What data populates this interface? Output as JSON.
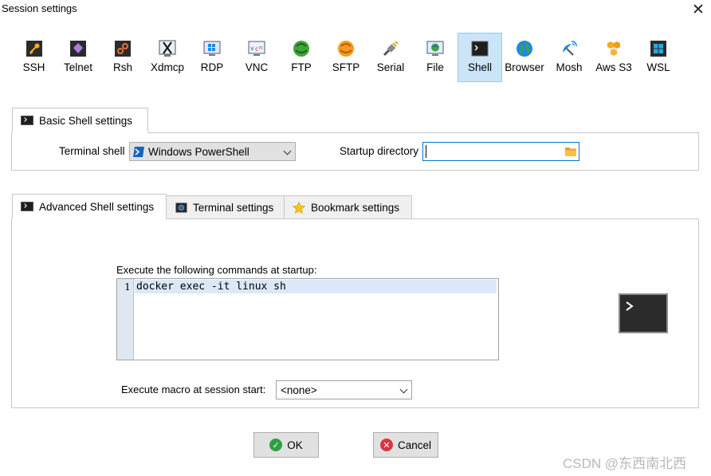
{
  "window": {
    "title": "Session settings",
    "close_glyph": "✕"
  },
  "toolbar": {
    "selected": "Shell",
    "items": [
      {
        "label": "SSH",
        "icon": "key-icon"
      },
      {
        "label": "Telnet",
        "icon": "telnet-icon"
      },
      {
        "label": "Rsh",
        "icon": "rsh-icon"
      },
      {
        "label": "Xdmcp",
        "icon": "xdmcp-icon"
      },
      {
        "label": "RDP",
        "icon": "rdp-icon"
      },
      {
        "label": "VNC",
        "icon": "vnc-icon"
      },
      {
        "label": "FTP",
        "icon": "ftp-icon"
      },
      {
        "label": "SFTP",
        "icon": "sftp-icon"
      },
      {
        "label": "Serial",
        "icon": "serial-plug-icon"
      },
      {
        "label": "File",
        "icon": "file-icon"
      },
      {
        "label": "Shell",
        "icon": "terminal-icon"
      },
      {
        "label": "Browser",
        "icon": "globe-icon"
      },
      {
        "label": "Mosh",
        "icon": "satellite-icon"
      },
      {
        "label": "Aws S3",
        "icon": "aws-s3-icon"
      },
      {
        "label": "WSL",
        "icon": "windows-icon"
      }
    ]
  },
  "basic": {
    "tab_label": "Basic Shell settings",
    "terminal_shell_label": "Terminal shell",
    "terminal_shell_value": "Windows PowerShell",
    "startup_dir_label": "Startup directory",
    "startup_dir_value": ""
  },
  "advanced": {
    "tabs": [
      {
        "label": "Advanced Shell settings",
        "active": true
      },
      {
        "label": "Terminal settings",
        "active": false
      },
      {
        "label": "Bookmark settings",
        "active": false
      }
    ],
    "commands_label": "Execute the following commands at startup:",
    "line_number": "1",
    "command_line": "docker exec -it linux sh",
    "macro_label": "Execute macro at session start:",
    "macro_value": "<none>"
  },
  "buttons": {
    "ok": "OK",
    "cancel": "Cancel"
  },
  "watermark": "CSDN @东西南北西",
  "colors": {
    "selected_bg": "#cce4f7",
    "selected_border": "#99c9ef",
    "focus_border": "#0078d7",
    "ok_green": "#2ea043",
    "cancel_red": "#d9363e"
  }
}
